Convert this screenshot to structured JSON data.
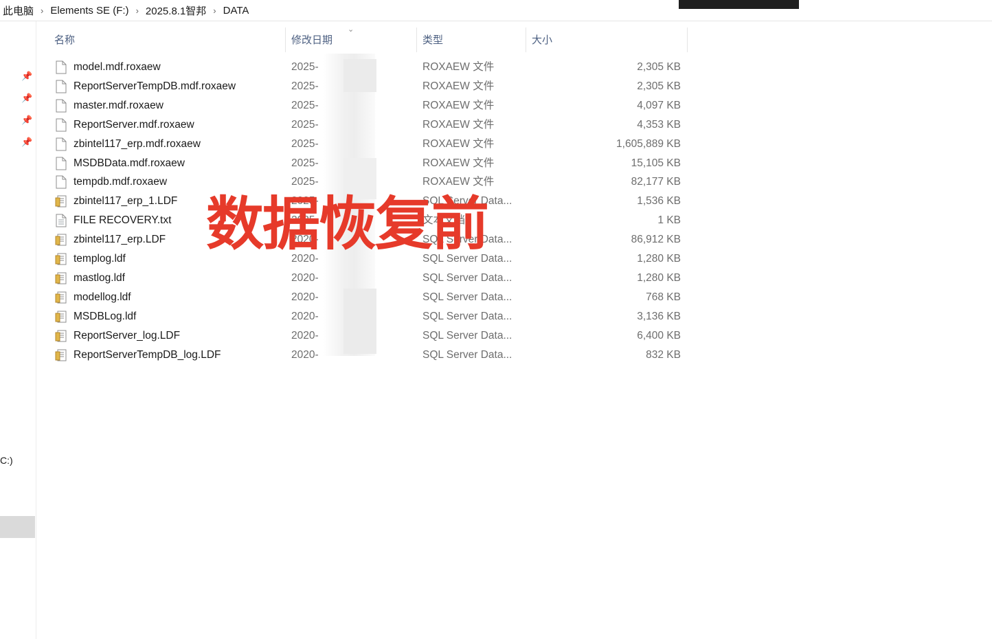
{
  "breadcrumb": {
    "items": [
      "此电脑",
      "Elements SE (F:)",
      "2025.8.1智邦",
      "DATA"
    ],
    "separator": "›"
  },
  "nav": {
    "drive_label": "C:)"
  },
  "columns": {
    "name": "名称",
    "modified": "修改日期",
    "type": "类型",
    "size": "大小"
  },
  "files": [
    {
      "name": "model.mdf.roxaew",
      "modified": "2025-",
      "type": "ROXAEW 文件",
      "size": "2,305 KB",
      "icon": "blank-file-icon"
    },
    {
      "name": "ReportServerTempDB.mdf.roxaew",
      "modified": "2025-",
      "type": "ROXAEW 文件",
      "size": "2,305 KB",
      "icon": "blank-file-icon"
    },
    {
      "name": "master.mdf.roxaew",
      "modified": "2025-",
      "type": "ROXAEW 文件",
      "size": "4,097 KB",
      "icon": "blank-file-icon"
    },
    {
      "name": "ReportServer.mdf.roxaew",
      "modified": "2025-",
      "type": "ROXAEW 文件",
      "size": "4,353 KB",
      "icon": "blank-file-icon"
    },
    {
      "name": "zbintel117_erp.mdf.roxaew",
      "modified": "2025-",
      "type": "ROXAEW 文件",
      "size": "1,605,889 KB",
      "icon": "blank-file-icon"
    },
    {
      "name": "MSDBData.mdf.roxaew",
      "modified": "2025-",
      "type": "ROXAEW 文件",
      "size": "15,105 KB",
      "icon": "blank-file-icon"
    },
    {
      "name": "tempdb.mdf.roxaew",
      "modified": "2025-",
      "type": "ROXAEW 文件",
      "size": "82,177 KB",
      "icon": "blank-file-icon"
    },
    {
      "name": "zbintel117_erp_1.LDF",
      "modified": "2025-",
      "type": "SQL Server Data...",
      "size": "1,536 KB",
      "icon": "sql-data-file-icon"
    },
    {
      "name": "FILE RECOVERY.txt",
      "modified": "2025-",
      "type": "文本文档",
      "size": "1 KB",
      "icon": "text-file-icon"
    },
    {
      "name": "zbintel117_erp.LDF",
      "modified": "2020-",
      "type": "SQL Server Data...",
      "size": "86,912 KB",
      "icon": "sql-data-file-icon"
    },
    {
      "name": "templog.ldf",
      "modified": "2020-",
      "type": "SQL Server Data...",
      "size": "1,280 KB",
      "icon": "sql-data-file-icon"
    },
    {
      "name": "mastlog.ldf",
      "modified": "2020-",
      "type": "SQL Server Data...",
      "size": "1,280 KB",
      "icon": "sql-data-file-icon"
    },
    {
      "name": "modellog.ldf",
      "modified": "2020-",
      "type": "SQL Server Data...",
      "size": "768 KB",
      "icon": "sql-data-file-icon"
    },
    {
      "name": "MSDBLog.ldf",
      "modified": "2020-",
      "type": "SQL Server Data...",
      "size": "3,136 KB",
      "icon": "sql-data-file-icon"
    },
    {
      "name": "ReportServer_log.LDF",
      "modified": "2020-",
      "type": "SQL Server Data...",
      "size": "6,400 KB",
      "icon": "sql-data-file-icon"
    },
    {
      "name": "ReportServerTempDB_log.LDF",
      "modified": "2020-",
      "type": "SQL Server Data...",
      "size": "832 KB",
      "icon": "sql-data-file-icon"
    }
  ],
  "overlay_text": "数据恢复前",
  "colors": {
    "overlay": "#e63a2a",
    "header_text": "#4d6082",
    "secondary_text": "#6d6d6d",
    "ldf_icon": "#e0b64a"
  }
}
